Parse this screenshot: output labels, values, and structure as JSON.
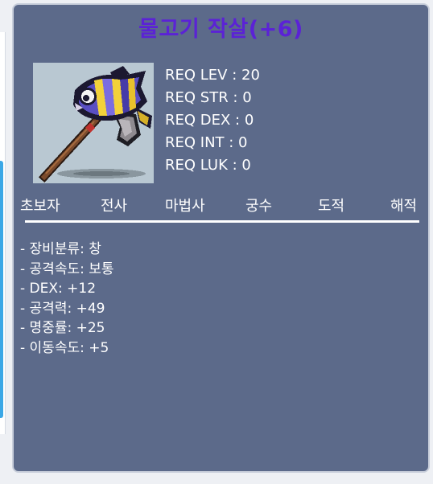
{
  "item": {
    "title": "물고기 작살(+6)",
    "title_color": "#5b22d6",
    "icon": "fish-harpoon-icon"
  },
  "requirements": [
    "REQ LEV : 20",
    "REQ STR : 0",
    "REQ DEX : 0",
    "REQ INT : 0",
    "REQ LUK : 0"
  ],
  "jobs": [
    "초보자",
    "전사",
    "마법사",
    "궁수",
    "도적",
    "해적"
  ],
  "stats": [
    "- 장비분류: 창",
    "- 공격속도: 보통",
    "- DEX: +12",
    "- 공격력: +49",
    "- 명중률: +25",
    "- 이동속도: +5"
  ],
  "colors": {
    "panel_bg": "#5c6a8a",
    "panel_border": "#c9cfdb",
    "text": "#ffffff",
    "icon_bg": "#b9c8d2"
  }
}
